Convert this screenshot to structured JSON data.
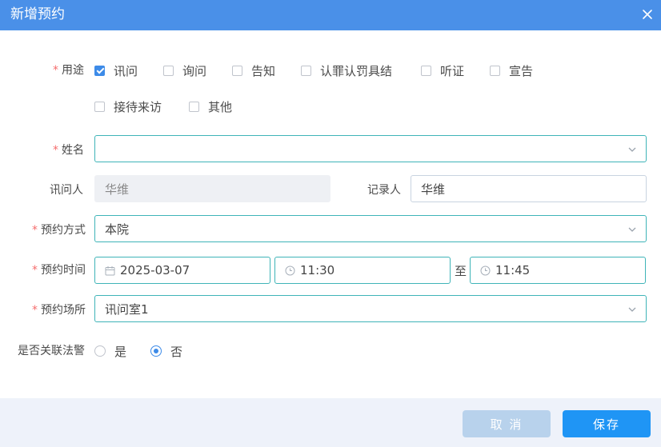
{
  "dialog": {
    "title": "新增预约"
  },
  "form": {
    "purpose": {
      "label": "用途",
      "options": [
        {
          "label": "讯问",
          "checked": true
        },
        {
          "label": "询问",
          "checked": false
        },
        {
          "label": "告知",
          "checked": false
        },
        {
          "label": "认罪认罚具结",
          "checked": false
        },
        {
          "label": "听证",
          "checked": false
        },
        {
          "label": "宣告",
          "checked": false
        },
        {
          "label": "接待来访",
          "checked": false
        },
        {
          "label": "其他",
          "checked": false
        }
      ]
    },
    "name": {
      "label": "姓名",
      "value": ""
    },
    "interrogator": {
      "label": "讯问人",
      "value": "华维"
    },
    "recorder": {
      "label": "记录人",
      "value": "华维"
    },
    "method": {
      "label": "预约方式",
      "value": "本院"
    },
    "time": {
      "label": "预约时间",
      "date": "2025-03-07",
      "start": "11:30",
      "separator": "至",
      "end": "11:45"
    },
    "place": {
      "label": "预约场所",
      "value": "讯问室1"
    },
    "police": {
      "label": "是否关联法警",
      "options": [
        "是",
        "否"
      ],
      "selected": "否"
    }
  },
  "footer": {
    "cancel_label": "取 消",
    "save_label": "保存"
  },
  "colors": {
    "header": "#4a90e8",
    "accent": "#3d8be8",
    "border": "#3fb4b8",
    "required": "#f56c6c",
    "save": "#1f95f5",
    "cancel": "#b8d2ec"
  }
}
